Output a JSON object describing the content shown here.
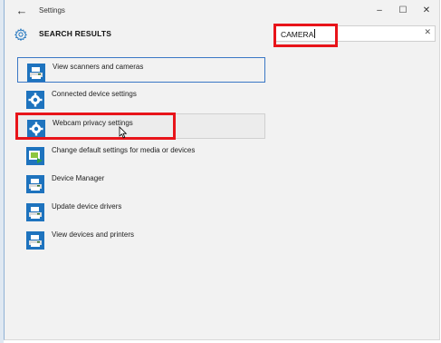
{
  "window": {
    "title": "Settings",
    "back_icon": "back-arrow-icon",
    "minimize": "–",
    "maximize": "☐",
    "close": "✕"
  },
  "header": {
    "label": "SEARCH RESULTS",
    "icon": "gear-icon"
  },
  "search": {
    "value": "CAMERA",
    "clear_icon": "close-icon"
  },
  "results": [
    {
      "label": "View scanners and cameras",
      "icon": "scanner-printer-icon"
    },
    {
      "label": "Connected device settings",
      "icon": "settings-gear-icon"
    },
    {
      "label": "Webcam privacy settings",
      "icon": "settings-gear-icon"
    },
    {
      "label": "Change default settings for media or devices",
      "icon": "autoplay-icon"
    },
    {
      "label": "Device Manager",
      "icon": "scanner-printer-icon"
    },
    {
      "label": "Update device drivers",
      "icon": "scanner-printer-icon"
    },
    {
      "label": "View devices and printers",
      "icon": "scanner-printer-icon"
    }
  ],
  "colors": {
    "highlight_box": "#e8141a",
    "icon_blue": "#1e73be",
    "focus_border": "#3b78c5"
  }
}
